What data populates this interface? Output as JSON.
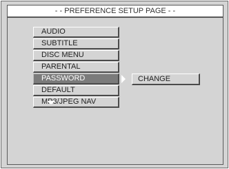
{
  "header": {
    "title": "- - PREFERENCE SETUP PAGE - -"
  },
  "menu": {
    "items": [
      {
        "label": "AUDIO"
      },
      {
        "label": "SUBTITLE"
      },
      {
        "label": "DISC MENU"
      },
      {
        "label": "PARENTAL"
      },
      {
        "label": "PASSWORD",
        "selected": true
      },
      {
        "label": "DEFAULT"
      },
      {
        "label": "MP3/JPEG NAV"
      }
    ],
    "more_indicator_icon": "down-arrow-icon"
  },
  "submenu": {
    "pointer_icon": "right-arrow-icon",
    "items": [
      {
        "label": "CHANGE"
      }
    ]
  },
  "colors": {
    "background": "#d4d4d4",
    "selected_item": "#7b7b7b",
    "selected_text": "#ffffff",
    "text": "#222222"
  }
}
